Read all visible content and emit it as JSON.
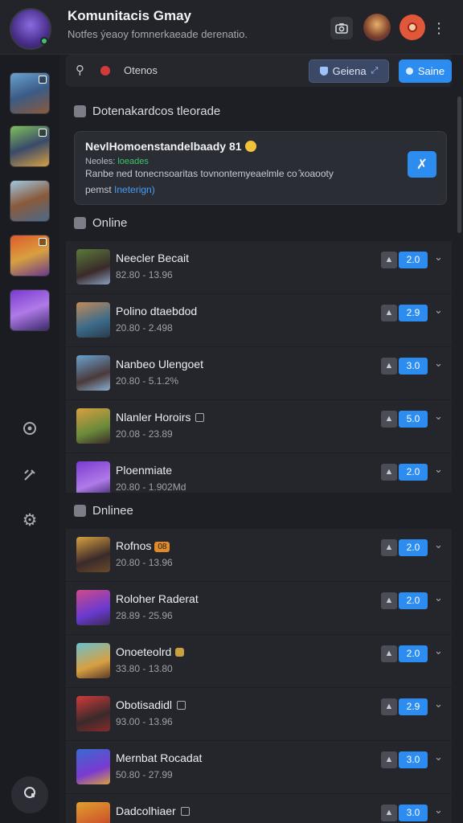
{
  "header": {
    "title": "Komunitacis Gmay",
    "subtitle": "Notfes ýeaoy  fomnerkaeade derenatio.",
    "more_label": "⋮"
  },
  "search": {
    "text": "Otenos",
    "filter_label": "Geiena",
    "primary_label": "Saine"
  },
  "sections": {
    "announcement": "Dotenakardcos tleorade",
    "online": "Online",
    "second": "Dnlinee"
  },
  "notice": {
    "title": "NevlHomoenstandelbaady 81",
    "line1_prefix": "Neoles:",
    "line1_green": "loeades",
    "line2": "Ranbe ned  tonecnsoaritas tovnontemyeaelmle co ̂xoaooty",
    "line3_prefix": "pemst",
    "line3_link": "Ineterign)",
    "action_icon": "wrench-icon"
  },
  "list_a": [
    {
      "name": "Neecler Becait",
      "meta": "82.80 - 13.96",
      "value": "2.0",
      "badge": ""
    },
    {
      "name": "Polino dtaebdod",
      "meta": "20.80 - 2.498",
      "value": "2.9",
      "badge": ""
    },
    {
      "name": "Nanbeo Ulengoet",
      "meta": "20.80 - 5.1.2%",
      "value": "3.0",
      "badge": ""
    },
    {
      "name": "Nlanler Horoirs",
      "meta": "20.08 - 23.89",
      "value": "5.0",
      "badge": "square"
    },
    {
      "name": "Ploenmiate",
      "meta": "20.80 - 1.902Md",
      "value": "2.0",
      "badge": ""
    }
  ],
  "list_b": [
    {
      "name": "Rofnos",
      "meta": "20.80 - 13.96",
      "value": "2.0",
      "badge": "orange",
      "badge_text": "08"
    },
    {
      "name": "Roloher Raderat",
      "meta": "28.89 - 25.96",
      "value": "2.0",
      "badge": ""
    },
    {
      "name": "Onoeteolrd",
      "meta": "33.80 - 13.80",
      "value": "2.0",
      "badge": "gold"
    },
    {
      "name": "Obotisadidl",
      "meta": "93.00 - 13.96",
      "value": "2.9",
      "badge": "square"
    },
    {
      "name": "Mernbat Rocadat",
      "meta": "50.80 - 27.99",
      "value": "3.0",
      "badge": ""
    },
    {
      "name": "Dadcolhiaer",
      "meta": "",
      "value": "3.0",
      "badge": "square"
    }
  ],
  "colors": {
    "accent": "#2d8cf0",
    "background": "#1e1f24",
    "online_dot": "#3cc46a"
  }
}
